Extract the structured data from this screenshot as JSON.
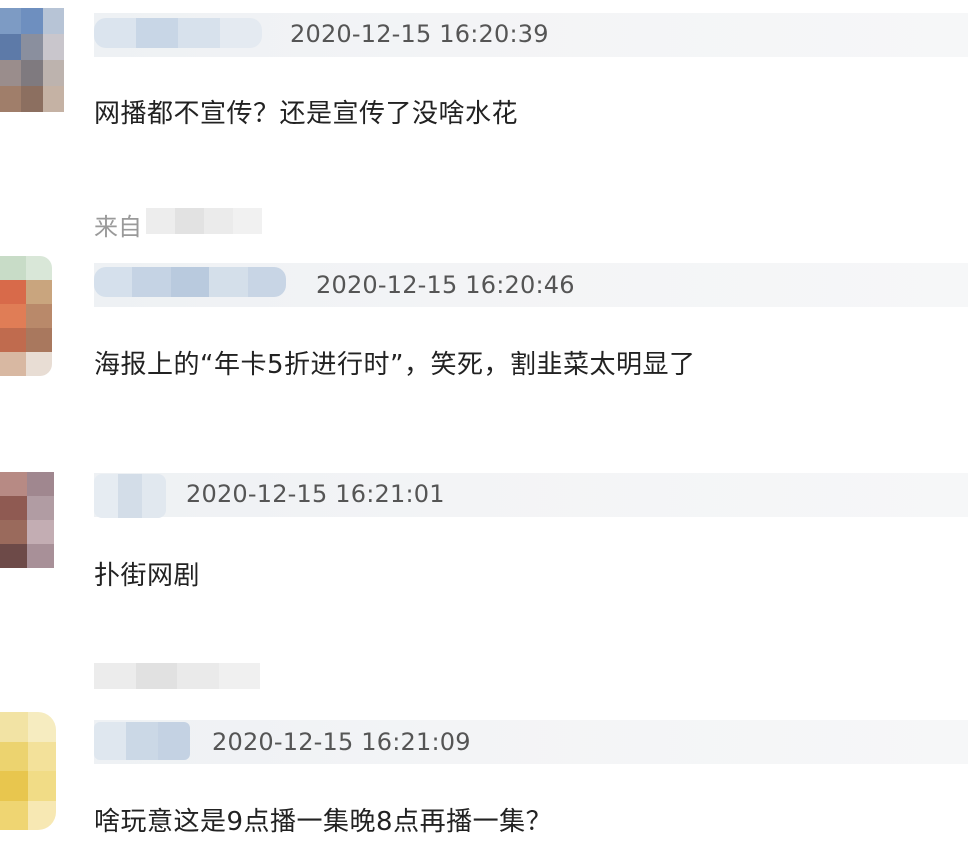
{
  "comments": [
    {
      "timestamp": "2020-12-15 16:20:39",
      "text": "网播都不宣传？还是宣传了没啥水花",
      "source_prefix": "来自"
    },
    {
      "timestamp": "2020-12-15 16:20:46",
      "text": "海报上的“年卡5折进行时”，笑死，割韭菜太明显了"
    },
    {
      "timestamp": "2020-12-15 16:21:01",
      "text": "扑街网剧"
    },
    {
      "timestamp": "2020-12-15 16:21:09",
      "text": "啥玩意这是9点播一集晚8点再播一集？"
    }
  ]
}
